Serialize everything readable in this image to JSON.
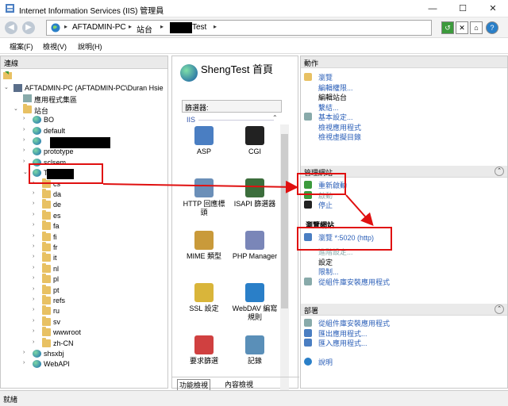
{
  "window": {
    "title": "Internet Information Services (IIS) 管理員",
    "minimize": "—",
    "maximize": "☐",
    "close": "✕"
  },
  "address": {
    "segments": [
      "AFTADMIN-PC",
      "站台",
      "Test"
    ],
    "separator": "▸"
  },
  "menu": [
    "檔案(F)",
    "檢視(V)",
    "說明(H)"
  ],
  "connections": {
    "header": "連線",
    "tree": [
      {
        "label": "AFTADMIN-PC (AFTADMIN-PC\\Duran Hsie",
        "exp": "⌄",
        "icon": "server-icon"
      },
      {
        "label": "應用程式集區",
        "exp": "",
        "icon": "app-pool-icon"
      },
      {
        "label": "站台",
        "exp": "⌄",
        "icon": "folder-icon"
      },
      {
        "label": "BO",
        "exp": "›",
        "icon": "globe-icon"
      },
      {
        "label": "default",
        "exp": "›",
        "icon": "globe-icon"
      },
      {
        "label": "",
        "exp": "›",
        "icon": "globe-icon"
      },
      {
        "label": "prototype",
        "exp": "›",
        "icon": "globe-icon"
      },
      {
        "label": "sclsem",
        "exp": "›",
        "icon": "globe-icon"
      },
      {
        "label": "Test",
        "exp": "⌄",
        "icon": "globe-icon"
      },
      {
        "label": "cs",
        "exp": "›",
        "icon": "folder-icon"
      },
      {
        "label": "da",
        "exp": "›",
        "icon": "folder-icon"
      },
      {
        "label": "de",
        "exp": "›",
        "icon": "folder-icon"
      },
      {
        "label": "es",
        "exp": "›",
        "icon": "folder-icon"
      },
      {
        "label": "fa",
        "exp": "›",
        "icon": "folder-icon"
      },
      {
        "label": "fi",
        "exp": "›",
        "icon": "folder-icon"
      },
      {
        "label": "fr",
        "exp": "›",
        "icon": "folder-icon"
      },
      {
        "label": "it",
        "exp": "›",
        "icon": "folder-icon"
      },
      {
        "label": "nl",
        "exp": "›",
        "icon": "folder-icon"
      },
      {
        "label": "pl",
        "exp": "›",
        "icon": "folder-icon"
      },
      {
        "label": "pt",
        "exp": "›",
        "icon": "folder-icon"
      },
      {
        "label": "refs",
        "exp": "›",
        "icon": "folder-icon"
      },
      {
        "label": "ru",
        "exp": "›",
        "icon": "folder-icon"
      },
      {
        "label": "sv",
        "exp": "›",
        "icon": "folder-icon"
      },
      {
        "label": "wwwroot",
        "exp": "›",
        "icon": "folder-icon"
      },
      {
        "label": "zh-CN",
        "exp": "›",
        "icon": "folder-icon"
      },
      {
        "label": "shsxbj",
        "exp": "›",
        "icon": "globe-icon"
      },
      {
        "label": "WebAPI",
        "exp": "›",
        "icon": "globe-icon"
      }
    ]
  },
  "features": {
    "title": "ShengTest 首頁",
    "filter_label": "篩選器:",
    "group": "IIS",
    "items": [
      {
        "label": "ASP",
        "icon": "asp-icon"
      },
      {
        "label": "CGI",
        "icon": "cgi-icon"
      },
      {
        "label": "HTTP 回應標頭",
        "icon": "http-headers-icon"
      },
      {
        "label": "ISAPI 篩選器",
        "icon": "isapi-filters-icon"
      },
      {
        "label": "MIME 類型",
        "icon": "mime-types-icon"
      },
      {
        "label": "PHP Manager",
        "icon": "php-manager-icon"
      },
      {
        "label": "SSL 設定",
        "icon": "ssl-settings-icon"
      },
      {
        "label": "WebDAV 編寫規則",
        "icon": "webdav-icon"
      },
      {
        "label": "要求篩選",
        "icon": "request-filtering-icon"
      },
      {
        "label": "記錄",
        "icon": "logging-icon"
      }
    ],
    "tab_features": "功能檢視",
    "tab_content": "內容檢視"
  },
  "actions": {
    "header": "動作",
    "top": [
      "瀏覽",
      "編輯權限...",
      "編輯站台",
      "繫結...",
      "基本設定...",
      "檢視應用程式",
      "檢視虛擬目錄"
    ],
    "manage_header": "管理網站",
    "manage": [
      "重新啟動",
      "啟動",
      "停止"
    ],
    "browse_header": "瀏覽網站",
    "browse": [
      "瀏覽 *:5020 (http)"
    ],
    "settings_items": [
      "進階設定...",
      "設定",
      "限制...",
      "從組件庫安裝應用程式"
    ],
    "deploy_header": "部署",
    "deploy": [
      "從組件庫安裝應用程式",
      "匯出應用程式...",
      "匯入應用程式..."
    ],
    "help": "說明"
  },
  "status": {
    "text": "就緒"
  },
  "colors": {
    "link": "#2b5fb8",
    "annotation": "#e01010"
  }
}
